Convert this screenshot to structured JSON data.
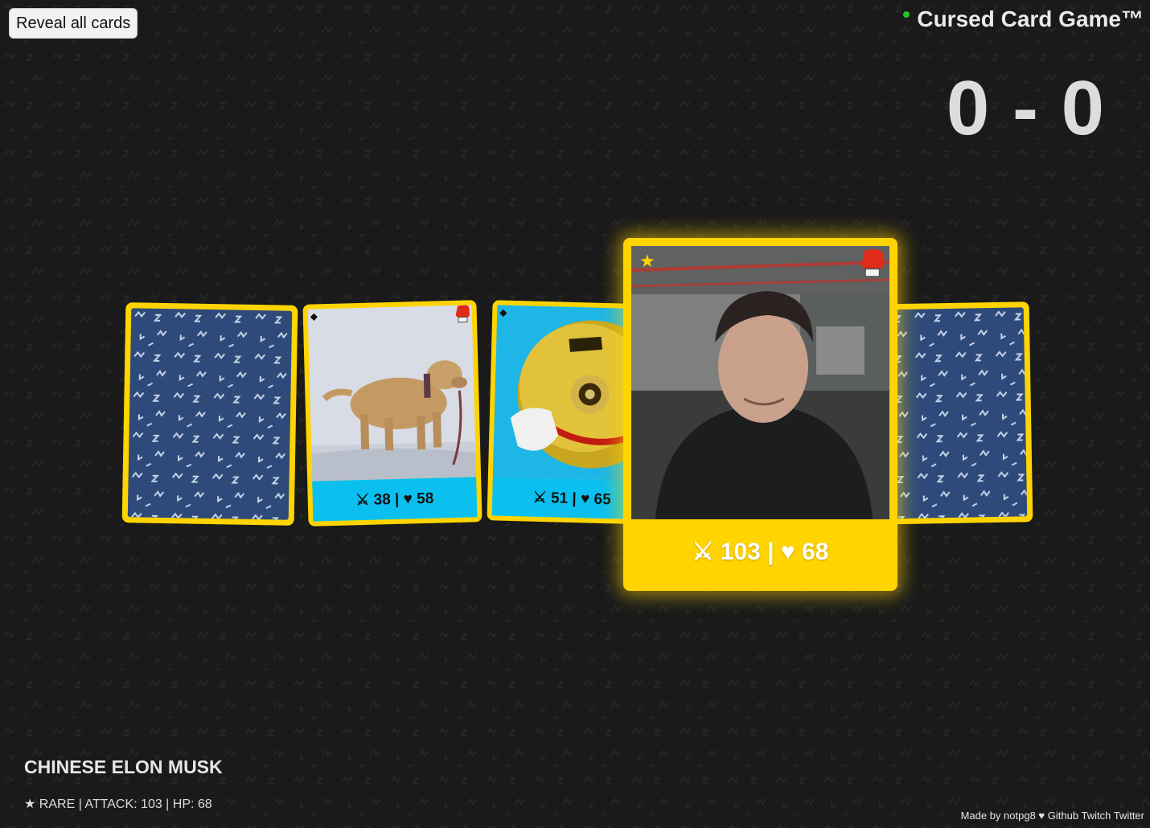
{
  "header": {
    "reveal_button_label": "Reveal all cards",
    "title": "Cursed Card Game™",
    "score": "0 - 0"
  },
  "cards": [
    {
      "state": "face-down"
    },
    {
      "state": "face-up",
      "rarity_icon": "diamond-icon",
      "rarity_symbol": "◆",
      "type_icon": "boxing-glove-icon",
      "attack": 38,
      "hp": 58,
      "stats_label": "⚔ 38 | ♥ 58",
      "bar_color": "#0bc0ee"
    },
    {
      "state": "face-up",
      "rarity_icon": "diamond-icon",
      "rarity_symbol": "◆",
      "attack": 51,
      "hp": 65,
      "stats_label": "⚔ 51 | ♥ 65",
      "bar_color": "#0bc0ee"
    },
    {
      "state": "face-up",
      "selected": true,
      "rarity_icon": "star-icon",
      "rarity_symbol": "★",
      "type_icon": "boxing-glove-icon",
      "attack": 103,
      "hp": 68,
      "stats_label": "⚔ 103 | ♥ 68",
      "bar_color": "#ffd400"
    },
    {
      "state": "face-down"
    }
  ],
  "selected_card": {
    "name": "CHINESE ELON MUSK",
    "meta": "★ RARE | ATTACK: 103 | HP: 68"
  },
  "footer": {
    "made_by": "Made by notpg8 ♥",
    "links": [
      "Github",
      "Twitch",
      "Twitter"
    ]
  },
  "colors": {
    "background": "#1a1a1a",
    "card_border": "#ffd400",
    "card_back": "#2e4a7a",
    "common_bar": "#0bc0ee",
    "rare_bar": "#ffd400",
    "status_dot": "#22c522"
  }
}
